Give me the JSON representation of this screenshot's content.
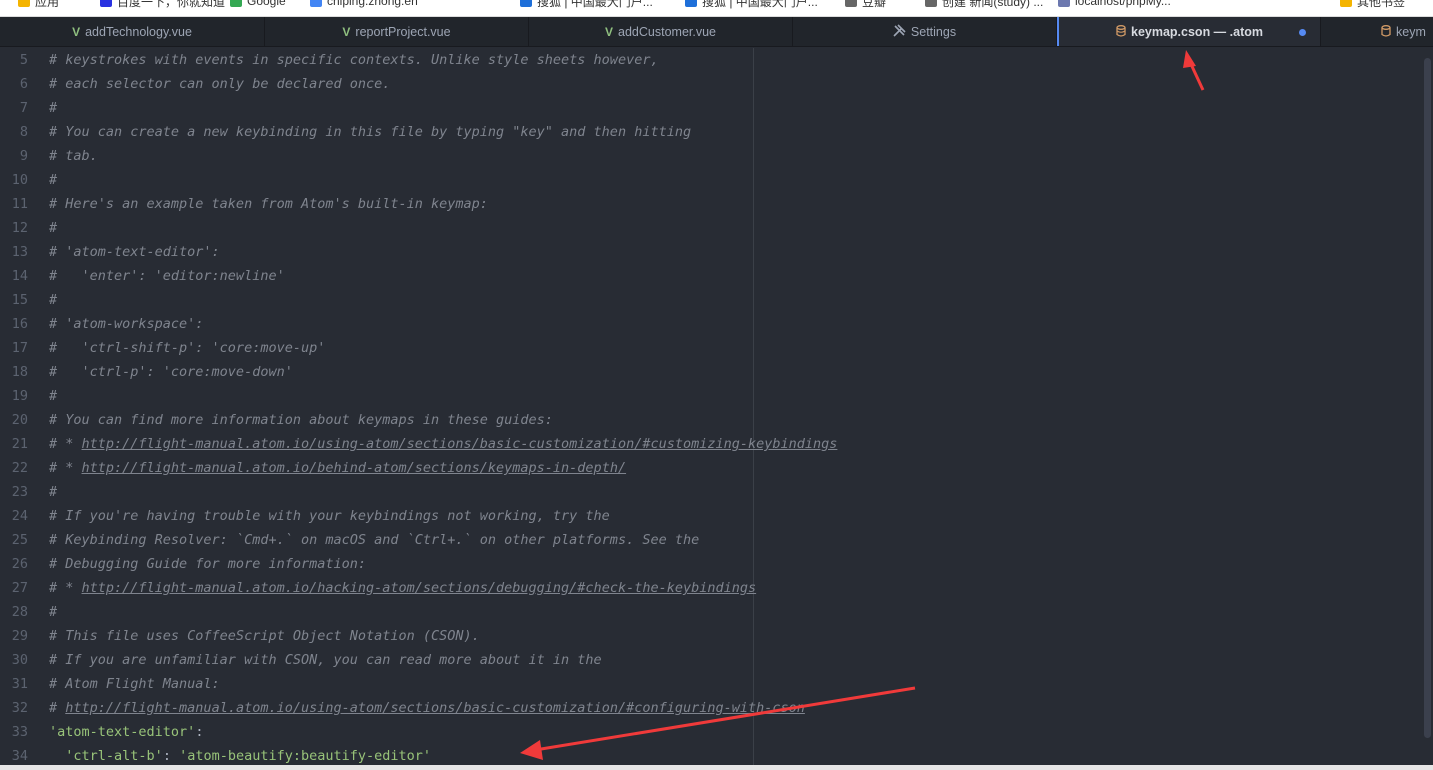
{
  "bookmarks": [
    {
      "label": "应用",
      "color": "#f4b400"
    },
    {
      "label": "百度一下，你就知道",
      "color": "#2932e1"
    },
    {
      "label": "Google",
      "color": "#34a853"
    },
    {
      "label": "chiping.zhong.en",
      "color": "#4285f4"
    },
    {
      "label": "搜狐 | 中国最大门户...",
      "color": "#1e6fd9"
    },
    {
      "label": "搜狐 | 中国最大门户...",
      "color": "#1e6fd9"
    },
    {
      "label": "豆瓣",
      "color": "#666666"
    },
    {
      "label": "创建 新闻(study) ...",
      "color": "#666666"
    },
    {
      "label": "localhost/phpMy...",
      "color": "#6c78af"
    },
    {
      "label": "其他书签",
      "color": "#f4b400"
    }
  ],
  "tabs": [
    {
      "label": "addTechnology.vue",
      "icon": "vue-icon"
    },
    {
      "label": "reportProject.vue",
      "icon": "vue-icon"
    },
    {
      "label": "addCustomer.vue",
      "icon": "vue-icon"
    },
    {
      "label": "Settings",
      "icon": "tools-icon"
    },
    {
      "label": "keymap.cson — .atom",
      "icon": "database-icon",
      "active": true,
      "modified": true
    },
    {
      "label": "keym",
      "icon": "database-icon"
    }
  ],
  "editor": {
    "lines": [
      {
        "n": "5",
        "t": "# keystrokes with events in specific contexts. Unlike style sheets however,"
      },
      {
        "n": "6",
        "t": "# each selector can only be declared once."
      },
      {
        "n": "7",
        "t": "#"
      },
      {
        "n": "8",
        "t": "# You can create a new keybinding in this file by typing \"key\" and then hitting"
      },
      {
        "n": "9",
        "t": "# tab."
      },
      {
        "n": "10",
        "t": "#"
      },
      {
        "n": "11",
        "t": "# Here's an example taken from Atom's built-in keymap:"
      },
      {
        "n": "12",
        "t": "#"
      },
      {
        "n": "13",
        "t": "# 'atom-text-editor':"
      },
      {
        "n": "14",
        "t": "#   'enter': 'editor:newline'"
      },
      {
        "n": "15",
        "t": "#"
      },
      {
        "n": "16",
        "t": "# 'atom-workspace':"
      },
      {
        "n": "17",
        "t": "#   'ctrl-shift-p': 'core:move-up'"
      },
      {
        "n": "18",
        "t": "#   'ctrl-p': 'core:move-down'"
      },
      {
        "n": "19",
        "t": "#"
      },
      {
        "n": "20",
        "t": "# You can find more information about keymaps in these guides:"
      },
      {
        "n": "21",
        "t": "# * ",
        "link": "http://flight-manual.atom.io/using-atom/sections/basic-customization/#customizing-keybindings"
      },
      {
        "n": "22",
        "t": "# * ",
        "link": "http://flight-manual.atom.io/behind-atom/sections/keymaps-in-depth/"
      },
      {
        "n": "23",
        "t": "#"
      },
      {
        "n": "24",
        "t": "# If you're having trouble with your keybindings not working, try the"
      },
      {
        "n": "25",
        "t": "# Keybinding Resolver: `Cmd+.` on macOS and `Ctrl+.` on other platforms. See the"
      },
      {
        "n": "26",
        "t": "# Debugging Guide for more information:"
      },
      {
        "n": "27",
        "t": "# * ",
        "link": "http://flight-manual.atom.io/hacking-atom/sections/debugging/#check-the-keybindings"
      },
      {
        "n": "28",
        "t": "#"
      },
      {
        "n": "29",
        "t": "# This file uses CoffeeScript Object Notation (CSON)."
      },
      {
        "n": "30",
        "t": "# If you are unfamiliar with CSON, you can read more about it in the"
      },
      {
        "n": "31",
        "t": "# Atom Flight Manual:"
      },
      {
        "n": "32",
        "t": "# ",
        "link": "http://flight-manual.atom.io/using-atom/sections/basic-customization/#configuring-with-cson"
      },
      {
        "n": "33",
        "code": true,
        "sel": "'atom-text-editor'",
        "rest": ":"
      },
      {
        "n": "34",
        "code": true,
        "indent": "  ",
        "key": "'ctrl-alt-b'",
        "sep": ": ",
        "val": "'atom-beautify:beautify-editor'"
      }
    ]
  },
  "colors": {
    "accent": "#568af2",
    "arrow": "#f03a3a",
    "string": "#98c379",
    "comment": "#7f848e"
  }
}
